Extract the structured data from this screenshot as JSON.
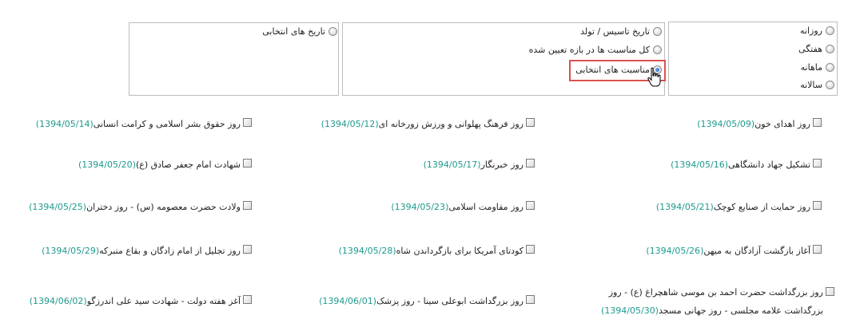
{
  "period_group": {
    "options": [
      {
        "label": "روزانه",
        "checked": false
      },
      {
        "label": "هفتگی",
        "checked": false
      },
      {
        "label": "ماهانه",
        "checked": false
      },
      {
        "label": "سالانه",
        "checked": false
      }
    ]
  },
  "type_group": {
    "options": [
      {
        "label": "تاریخ تاسیس / تولد",
        "checked": false
      },
      {
        "label": "کل مناسبت ها در بازه تعیین شده",
        "checked": false
      },
      {
        "label": "مناسبت های انتخابی",
        "checked": true
      }
    ]
  },
  "custom_group": {
    "options": [
      {
        "label": "تاریخ های انتخابی",
        "checked": false
      }
    ]
  },
  "occasions": [
    {
      "name": "روز اهدای خون",
      "date": "(1394/05/09)",
      "checked": false
    },
    {
      "name": "روز فرهنگ پهلوانی و ورزش زورخانه ای",
      "date": "(1394/05/12)",
      "checked": false
    },
    {
      "name": "روز حقوق بشر اسلامی و کرامت انسانی",
      "date": "(1394/05/14)",
      "checked": false
    },
    {
      "name": "تشکیل جهاد دانشگاهی",
      "date": "(1394/05/16)",
      "checked": false
    },
    {
      "name": "روز خبرنگار",
      "date": "(1394/05/17)",
      "checked": false
    },
    {
      "name": "شهادت امام جعفر صادق (ع)",
      "date": "(1394/05/20)",
      "checked": false
    },
    {
      "name": "روز حمایت از صنایع کوچک",
      "date": "(1394/05/21)",
      "checked": false
    },
    {
      "name": "روز مقاومت اسلامی",
      "date": "(1394/05/23)",
      "checked": false
    },
    {
      "name": "ولادت حضرت معصومه (س) - روز دختران",
      "date": "(1394/05/25)",
      "checked": false
    },
    {
      "name": "آغاز بازگشت آزادگان به میهن",
      "date": "(1394/05/26)",
      "checked": false
    },
    {
      "name": "کودتای آمریکا برای بازگرداندن شاه",
      "date": "(1394/05/28)",
      "checked": false
    },
    {
      "name": "روز تجلیل از امام زادگان و بقاع متبرکه",
      "date": "(1394/05/29)",
      "checked": false
    },
    {
      "name": "روز بزرگداشت حضرت احمد بن موسی شاهچراغ (ع) - روز بزرگداشت علامه مجلسی - روز جهانی مسجد",
      "date": "(1394/05/30)",
      "checked": false
    },
    {
      "name": "روز بزرگداشت ابوعلی سینا - روز پزشک",
      "date": "(1394/06/01)",
      "checked": false
    },
    {
      "name": "آغز هفته دولت - شهادت سید علی اندرزگو",
      "date": "(1394/06/02)",
      "checked": false
    }
  ]
}
